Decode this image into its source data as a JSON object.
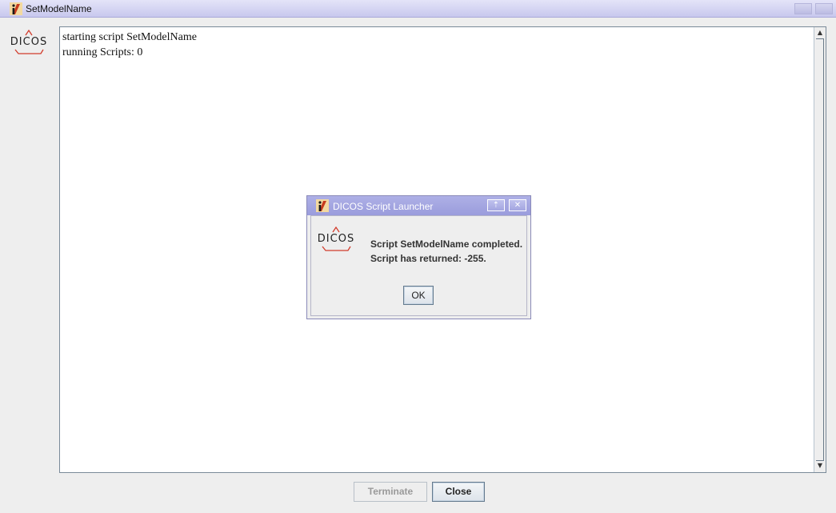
{
  "window": {
    "title": "SetModelName",
    "icon": "java-app-icon",
    "logo_text": "DICOS"
  },
  "log": {
    "lines": [
      "starting script SetModelName",
      "running Scripts: 0"
    ]
  },
  "buttons": {
    "terminate": "Terminate",
    "close": "Close"
  },
  "dialog": {
    "title": "DICOS Script Launcher",
    "logo_text": "DICOS",
    "message_line1": "Script SetModelName completed.",
    "message_line2": "Script has returned: -255.",
    "ok": "OK",
    "restore_glyph": "⇡",
    "close_glyph": "✕"
  },
  "colors": {
    "logo_accent": "#d23c2c",
    "titlebar": "#c8c8ee",
    "dialog_titlebar": "#9a9cdc"
  }
}
